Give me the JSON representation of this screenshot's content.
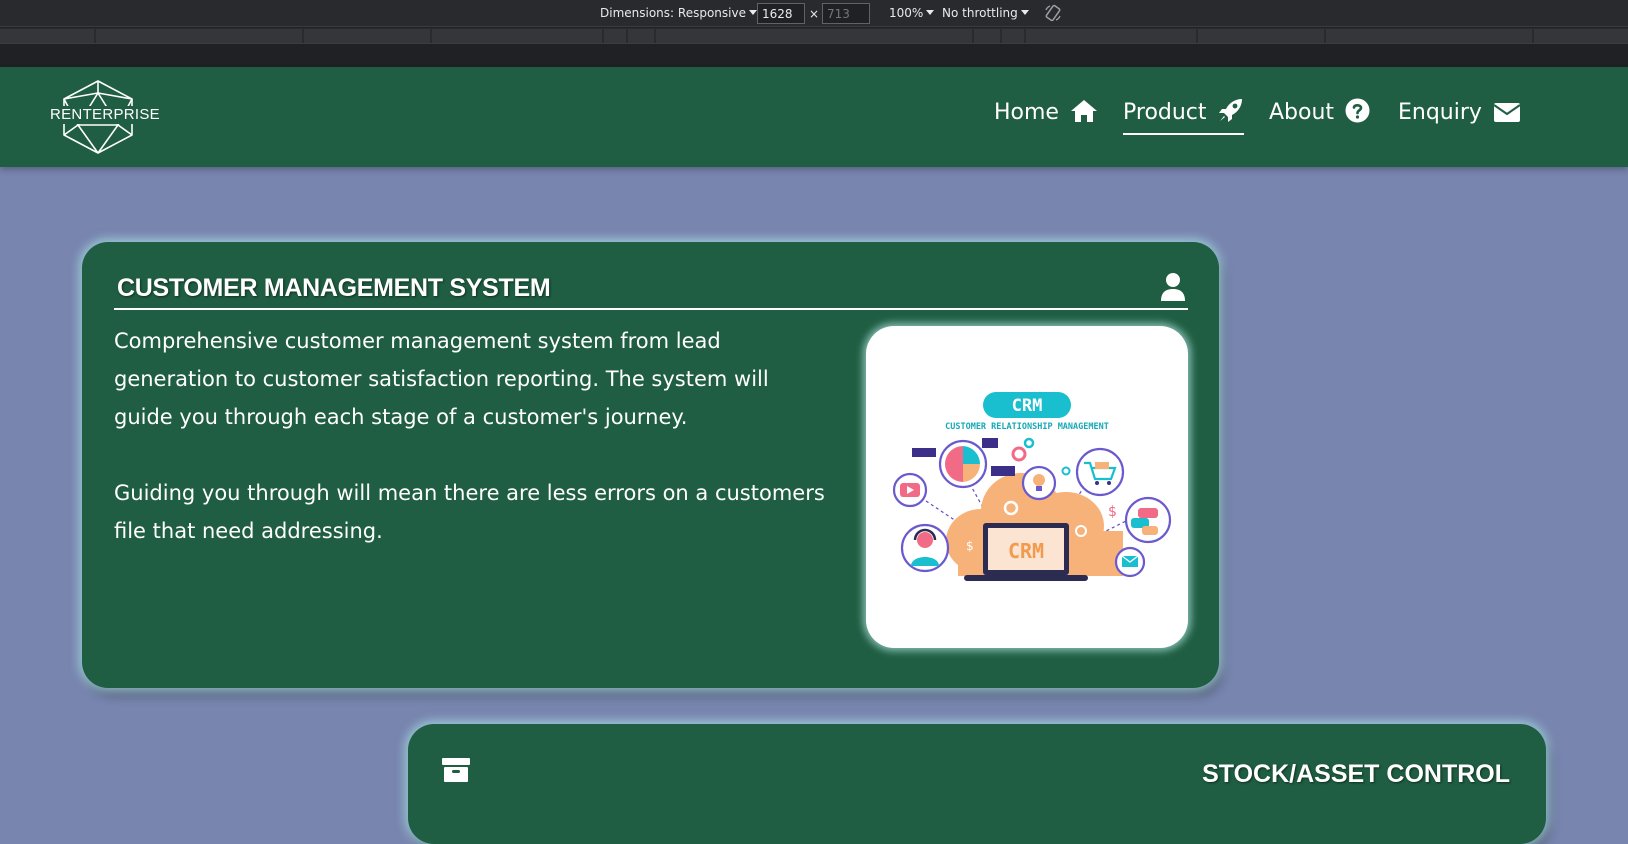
{
  "devtools": {
    "dimensions_label": "Dimensions: Responsive",
    "width_value": "1628",
    "height_placeholder": "713",
    "times_sign": "×",
    "zoom": "100%",
    "throttling": "No throttling"
  },
  "header": {
    "logo_text": "RENTERPRISE",
    "nav": [
      {
        "label": "Home",
        "icon": "home-icon",
        "active": false
      },
      {
        "label": "Product",
        "icon": "rocket-icon",
        "active": true
      },
      {
        "label": "About",
        "icon": "question-circle-icon",
        "active": false
      },
      {
        "label": "Enquiry",
        "icon": "envelope-icon",
        "active": false
      }
    ]
  },
  "cards": [
    {
      "title": "CUSTOMER MANAGEMENT SYSTEM",
      "icon": "user-icon",
      "paragraphs": [
        "Comprehensive customer management system from lead generation to customer satisfaction reporting. The system will guide you through each stage of a customer's journey.",
        "Guiding you through will mean there are less errors on a customers file that need addressing."
      ],
      "image": {
        "badge": "CRM",
        "subtitle": "CUSTOMER RELATIONSHIP MANAGEMENT",
        "screen_text": "CRM"
      }
    },
    {
      "title": "STOCK/ASSET CONTROL",
      "icon": "archive-icon"
    }
  ],
  "colors": {
    "page_bg": "#7885af",
    "header_bg": "#1f5e42",
    "card_bg": "#1f5e42",
    "card_glow": "#aae1e6",
    "devtools_bg": "#292a2d"
  }
}
